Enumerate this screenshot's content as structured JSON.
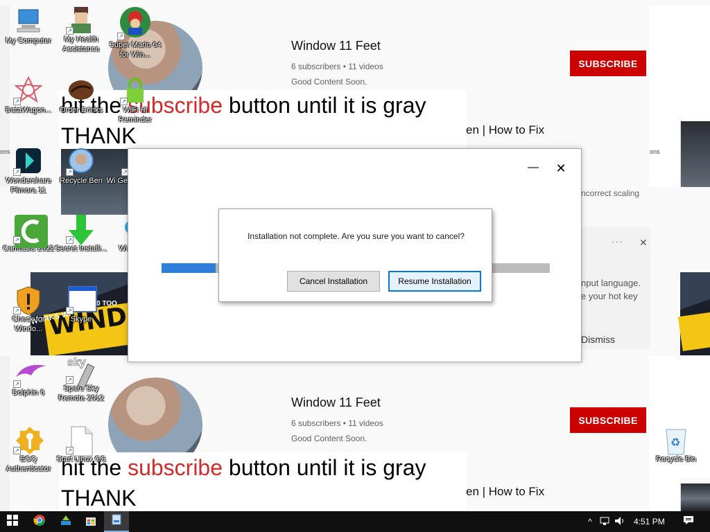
{
  "youtube_top": {
    "channel_name": "Window 11 Feet",
    "stats": "6 subscribers • 11 videos",
    "description": "Good Content Soon.",
    "subscribe_label": "SUBSCRIBE",
    "banner_pre": "hit the ",
    "banner_red": "subscribe",
    "banner_post": " button until it is gray",
    "banner_line2": "THANK",
    "title_fragment": "en | How to Fix"
  },
  "youtube_bottom": {
    "channel_name": "Window 11 Feet",
    "stats": "6 subscribers • 11 videos",
    "description": "Good Content Soon.",
    "subscribe_label": "SUBSCRIBE",
    "banner_pre": "hit the ",
    "banner_red": "subscribe",
    "banner_post": " button until it is gray",
    "banner_line2": "THANK",
    "title_fragment": "en | How to Fix"
  },
  "fragments": {
    "incorrect_scaling": "ncorrect scaling",
    "input_language": "nput language.",
    "hot_key": "e your hot key",
    "dismiss": "Dismiss",
    "ons_left": "ons",
    "ons_right": "ons",
    "thumb_text_big": "WINDOW",
    "thumb_text_small": "WORKS WI",
    "thumb_text_count": "S 10 TOO"
  },
  "desktop_icons": [
    {
      "label": "My Computer",
      "icon": "computer-icon"
    },
    {
      "label": "My Health Assistance",
      "icon": "avatar-icon"
    },
    {
      "label": "Super Mario 64 for Win...",
      "icon": "mario-icon"
    },
    {
      "label": "DataWagon...",
      "icon": "datawagon-icon"
    },
    {
      "label": "Order Drinks",
      "icon": "coffee-bean-icon"
    },
    {
      "label": "WiFi Hi Reminder",
      "icon": "wifi-lock-icon"
    },
    {
      "label": "Wondershare Filmora 11",
      "icon": "filmora-icon"
    },
    {
      "label": "Recycle Ben",
      "icon": "recycle-ben-icon"
    },
    {
      "label": "Wi Ge",
      "icon": "partial-icon"
    },
    {
      "label": "Camtasia 2022",
      "icon": "camtasia-icon"
    },
    {
      "label": "Secret Installi...",
      "icon": "download-arrow-icon"
    },
    {
      "label": "Wi",
      "icon": "partial-icon"
    },
    {
      "label": "Check for Windo...",
      "icon": "shield-warning-icon"
    },
    {
      "label": "Skype",
      "icon": "window-icon"
    },
    {
      "label": "Dolphin 6",
      "icon": "dolphin-icon"
    },
    {
      "label": "Spare Sky Remote 2012",
      "icon": "remote-icon"
    },
    {
      "label": "EOQ Authenticator",
      "icon": "key-icon"
    },
    {
      "label": "Start Linux OS",
      "icon": "file-icon"
    },
    {
      "label": "Recycle Bin",
      "icon": "recycle-bin-icon"
    }
  ],
  "installer": {
    "minimize_glyph": "—",
    "close_glyph": "✕",
    "progress_percent": 14
  },
  "confirm": {
    "message": "Installation not complete. Are you sure you want to cancel?",
    "cancel_label": "Cancel Installation",
    "resume_label": "Resume Installation"
  },
  "taskbar": {
    "time": "4:51 PM",
    "apps": [
      "start-icon",
      "chrome-icon",
      "app-icon",
      "store-icon",
      "installer-app-icon"
    ]
  },
  "colors": {
    "subscribe_red": "#cc0000",
    "progress_blue": "#2f7ed8",
    "banner_red": "#d42a2a"
  }
}
